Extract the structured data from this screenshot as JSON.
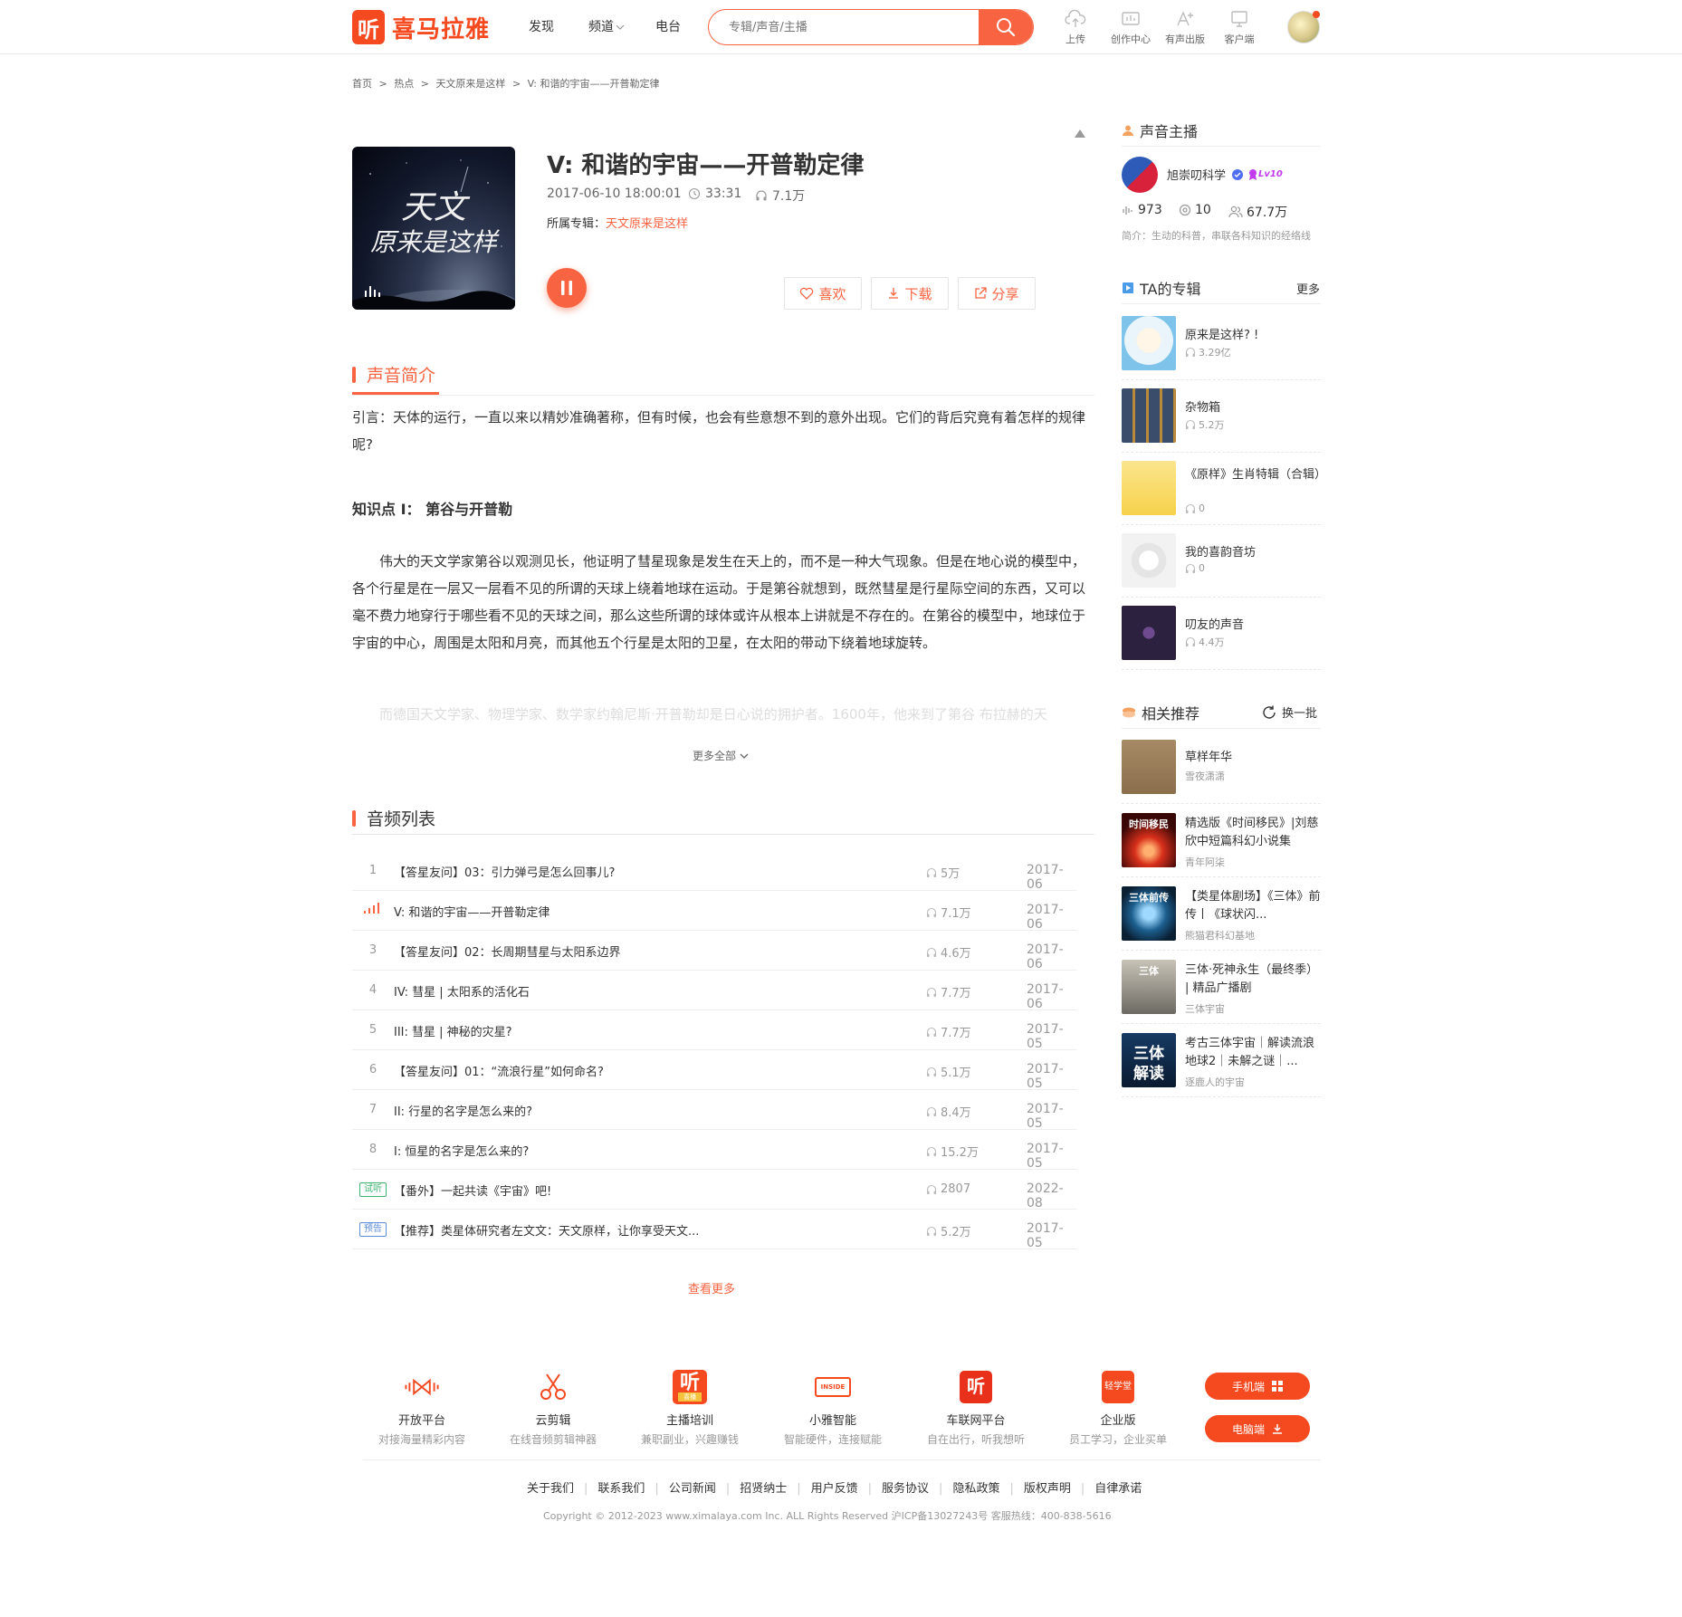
{
  "header": {
    "logo_glyph": "听",
    "logo_text": "喜马拉雅",
    "nav": [
      "发现",
      "频道",
      "电台"
    ],
    "search_placeholder": "专辑/声音/主播",
    "tools": [
      "上传",
      "创作中心",
      "有声出版",
      "客户端"
    ]
  },
  "breadcrumb": [
    "首页",
    ">",
    "热点",
    ">",
    "天文原来是这样",
    ">",
    "V: 和谐的宇宙——开普勒定律"
  ],
  "track": {
    "cover_line1": "天文",
    "cover_line2": "原来是这样",
    "title": "V: 和谐的宇宙——开普勒定律",
    "date": "2017-06-10 18:00:01",
    "duration": "33:31",
    "plays": "7.1万",
    "album_label": "所属专辑：",
    "album_name": "天文原来是这样",
    "buttons": {
      "like": "喜欢",
      "download": "下载",
      "share": "分享"
    }
  },
  "intro": {
    "heading": "声音简介",
    "lead": "引言：天体的运行，一直以来以精妙准确著称，但有时候，也会有些意想不到的意外出现。它们的背后究竟有着怎样的规律呢?",
    "point_title": "知识点 I：  第谷与开普勒",
    "para1": "伟大的天文学家第谷以观测见长，他证明了彗星现象是发生在天上的，而不是一种大气现象。但是在地心说的模型中，各个行星是在一层又一层看不见的所谓的天球上绕着地球在运动。于是第谷就想到，既然彗星是行星际空间的东西，又可以毫不费力地穿行于哪些看不见的天球之间，那么这些所谓的球体或许从根本上讲就是不存在的。在第谷的模型中，地球位于宇宙的中心，周围是太阳和月亮，而其他五个行星是太阳的卫星，在太阳的带动下绕着地球旋转。",
    "para2_faded": "而德国天文学家、物理学家、数学家约翰尼斯·开普勒却是日心说的拥护者。1600年，他来到了第谷 布拉赫的天",
    "more_all": "更多全部"
  },
  "audio_list": {
    "heading": "音频列表",
    "rows": [
      {
        "idx": "1",
        "tag": "",
        "title": "【答星友问】03：引力弹弓是怎么回事儿?",
        "plays": "5万",
        "date": "2017-06"
      },
      {
        "idx": "",
        "tag": "",
        "title": "V: 和谐的宇宙——开普勒定律",
        "plays": "7.1万",
        "date": "2017-06"
      },
      {
        "idx": "3",
        "tag": "",
        "title": "【答星友问】02：长周期彗星与太阳系边界",
        "plays": "4.6万",
        "date": "2017-06"
      },
      {
        "idx": "4",
        "tag": "",
        "title": "IV: 彗星 | 太阳系的活化石",
        "plays": "7.7万",
        "date": "2017-06"
      },
      {
        "idx": "5",
        "tag": "",
        "title": "III: 彗星 | 神秘的灾星?",
        "plays": "7.7万",
        "date": "2017-05"
      },
      {
        "idx": "6",
        "tag": "",
        "title": "【答星友问】01：“流浪行星”如何命名?",
        "plays": "5.1万",
        "date": "2017-05"
      },
      {
        "idx": "7",
        "tag": "",
        "title": "II: 行星的名字是怎么来的?",
        "plays": "8.4万",
        "date": "2017-05"
      },
      {
        "idx": "8",
        "tag": "",
        "title": "I: 恒星的名字是怎么来的?",
        "plays": "15.2万",
        "date": "2017-05"
      },
      {
        "idx": "",
        "tag": "试听",
        "title": "【番外】一起共读《宇宙》吧!",
        "plays": "2807",
        "date": "2022-08"
      },
      {
        "idx": "",
        "tag": "预告",
        "title": "【推荐】类星体研究者左文文：天文原样，让你享受天文...",
        "plays": "5.2万",
        "date": "2017-05"
      }
    ],
    "see_more": "查看更多"
  },
  "sidebar": {
    "anchor_heading": "声音主播",
    "anchor_name": "旭崇叨科学",
    "anchor_level": "Lv10",
    "stats": {
      "tracks": "973",
      "albums": "10",
      "fans": "67.7万"
    },
    "anchor_intro": "简介：生动的科普，串联各科知识的经络线",
    "albums_heading": "TA的专辑",
    "albums_more": "更多",
    "albums": [
      {
        "title": "原来是这样? !",
        "plays": "3.29亿"
      },
      {
        "title": "杂物箱",
        "plays": "5.2万"
      },
      {
        "title": "《原样》生肖特辑（合辑）",
        "plays": "0"
      },
      {
        "title": "我的喜韵音坊",
        "plays": "0"
      },
      {
        "title": "叨友的声音",
        "plays": "4.4万"
      }
    ],
    "related_heading": "相关推荐",
    "related_refresh": "换一批",
    "related": [
      {
        "title": "草样年华",
        "author": "雪夜潇潇"
      },
      {
        "title": "精选版《时间移民》|刘慈欣中短篇科幻小说集",
        "author": "青年阿柒"
      },
      {
        "title": "【类星体剧场】《三体》前传丨《球状闪...",
        "author": "熊猫君科幻基地"
      },
      {
        "title": "三体·死神永生（最终季） | 精品广播剧",
        "author": "三体宇宙"
      },
      {
        "title": "考古三体宇宙｜解读流浪地球2｜未解之谜｜...",
        "author": "逐鹿人的宇宙"
      }
    ],
    "related_thumb_text": {
      "r2": "时间移民",
      "r3": "三体前传",
      "r4": "三体",
      "r5a": "三体",
      "r5b": "解读"
    }
  },
  "footer": {
    "items": [
      {
        "name": "开放平台",
        "desc": "对接海量精彩内容"
      },
      {
        "name": "云剪辑",
        "desc": "在线音频剪辑神器"
      },
      {
        "name": "主播培训",
        "desc": "兼职副业，兴趣赚钱"
      },
      {
        "name": "小雅智能",
        "desc": "智能硬件，连接赋能"
      },
      {
        "name": "车联网平台",
        "desc": "自在出行，听我想听"
      },
      {
        "name": "企业版",
        "desc": "员工学习，企业买单"
      }
    ],
    "icon_text": {
      "train_badge": "喜播",
      "xiaoya": "INSIDE",
      "enterprise": "轻学堂"
    },
    "btn_mobile": "手机端",
    "btn_pc": "电脑端",
    "links": [
      "关于我们",
      "联系我们",
      "公司新闻",
      "招贤纳士",
      "用户反馈",
      "服务协议",
      "隐私政策",
      "版权声明",
      "自律承诺"
    ],
    "copyright": "Copyright © 2012-2023 www.ximalaya.com Inc. ALL Rights Reserved  沪ICP备13027243号  客服热线：400-838-5616"
  },
  "colors": {
    "brand": "#f5491f",
    "accent": "#f86442"
  }
}
